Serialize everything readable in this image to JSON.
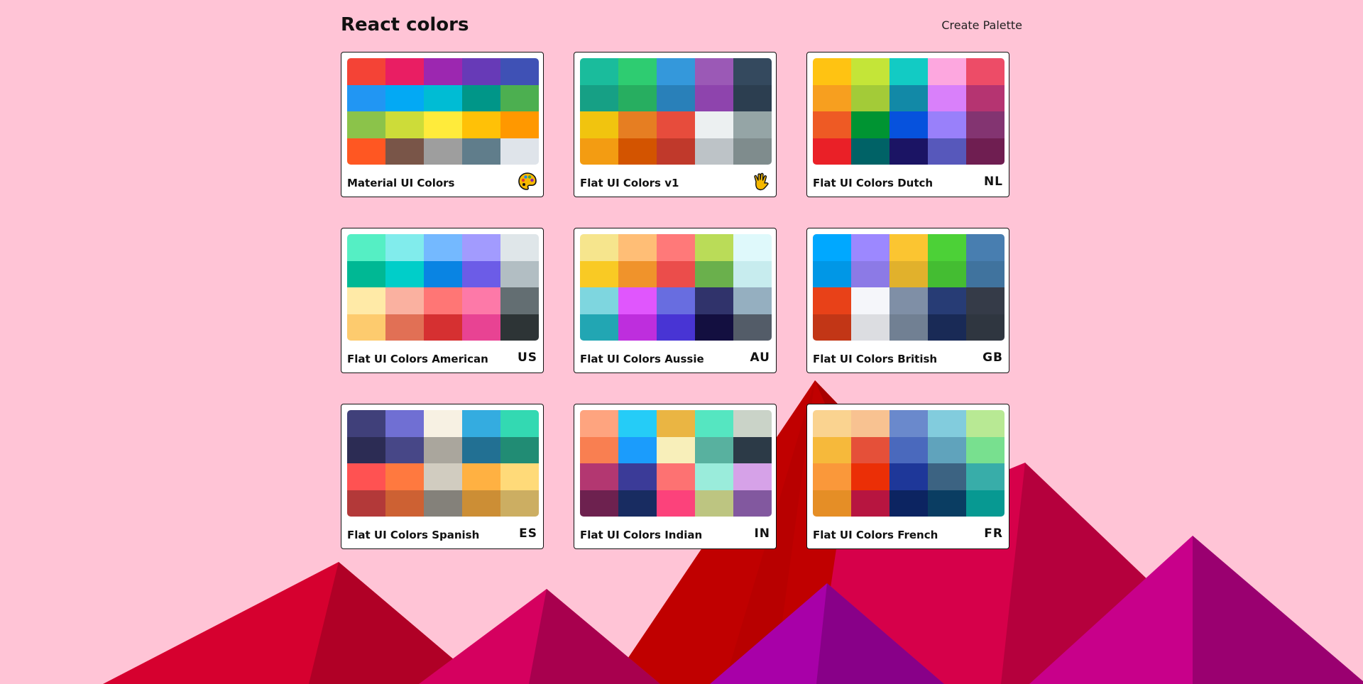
{
  "header": {
    "title": "React colors",
    "create_label": "Create Palette"
  },
  "palettes": [
    {
      "name": "Material UI Colors",
      "emoji": "palette-icon",
      "colors": [
        "#f44336",
        "#e91e63",
        "#9c27b0",
        "#673ab7",
        "#3f51b5",
        "#2196f3",
        "#03a9f4",
        "#00bcd4",
        "#009688",
        "#4caf50",
        "#8bc34a",
        "#cddc39",
        "#ffeb3b",
        "#ffc107",
        "#ff9800",
        "#ff5722",
        "#795548",
        "#9e9e9e",
        "#607d8b",
        "#dfe4ea"
      ]
    },
    {
      "name": "Flat UI Colors v1",
      "emoji": "hand-icon",
      "colors": [
        "#1abc9c",
        "#2ecc71",
        "#3498db",
        "#9b59b6",
        "#34495e",
        "#16a085",
        "#27ae60",
        "#2980b9",
        "#8e44ad",
        "#2c3e50",
        "#f1c40f",
        "#e67e22",
        "#e74c3c",
        "#ecf0f1",
        "#95a5a6",
        "#f39c12",
        "#d35400",
        "#c0392b",
        "#bdc3c7",
        "#7f8c8d"
      ]
    },
    {
      "name": "Flat UI Colors Dutch",
      "emoji": "NL",
      "colors": [
        "#ffc312",
        "#c4e538",
        "#12cbc4",
        "#fda7df",
        "#ed4c67",
        "#f79f1f",
        "#a3cb38",
        "#1289a7",
        "#d980fa",
        "#b53471",
        "#ee5a24",
        "#009432",
        "#0652dd",
        "#9980fa",
        "#833471",
        "#ea2027",
        "#006266",
        "#1b1464",
        "#5758bb",
        "#6f1e51"
      ]
    },
    {
      "name": "Flat UI Colors American",
      "emoji": "US",
      "colors": [
        "#55efc4",
        "#81ecec",
        "#74b9ff",
        "#a29bfe",
        "#dfe6e9",
        "#00b894",
        "#00cec9",
        "#0984e3",
        "#6c5ce7",
        "#b2bec3",
        "#ffeaa7",
        "#fab1a0",
        "#ff7675",
        "#fd79a8",
        "#636e72",
        "#fdcb6e",
        "#e17055",
        "#d63031",
        "#e84393",
        "#2d3436"
      ]
    },
    {
      "name": "Flat UI Colors Aussie",
      "emoji": "AU",
      "colors": [
        "#f6e58d",
        "#ffbe76",
        "#ff7979",
        "#badc58",
        "#dff9fb",
        "#f9ca24",
        "#f0932b",
        "#eb4d4b",
        "#6ab04c",
        "#c7ecee",
        "#7ed6df",
        "#e056fd",
        "#686de0",
        "#30336b",
        "#95afc0",
        "#22a6b3",
        "#be2edd",
        "#4834d4",
        "#130f40",
        "#535c68"
      ]
    },
    {
      "name": "Flat UI Colors British",
      "emoji": "GB",
      "colors": [
        "#00a8ff",
        "#9c88ff",
        "#fbc531",
        "#4cd137",
        "#487eb0",
        "#0097e6",
        "#8c7ae6",
        "#e1b12c",
        "#44bd32",
        "#40739e",
        "#e84118",
        "#f5f6fa",
        "#7f8fa6",
        "#273c75",
        "#353b48",
        "#c23616",
        "#dcdde1",
        "#718093",
        "#192a56",
        "#2f3640"
      ]
    },
    {
      "name": "Flat UI Colors Spanish",
      "emoji": "ES",
      "colors": [
        "#40407a",
        "#706fd3",
        "#f7f1e3",
        "#34ace0",
        "#33d9b2",
        "#2c2c54",
        "#474787",
        "#aaa69d",
        "#227093",
        "#218c74",
        "#ff5252",
        "#ff793f",
        "#d1ccc0",
        "#ffb142",
        "#ffda79",
        "#b33939",
        "#cd6133",
        "#84817a",
        "#cc8e35",
        "#ccae62"
      ]
    },
    {
      "name": "Flat UI Colors Indian",
      "emoji": "IN",
      "colors": [
        "#fea47f",
        "#25ccf7",
        "#eab543",
        "#55e6c1",
        "#cad3c8",
        "#f97f51",
        "#1b9cfc",
        "#f8efba",
        "#58b19f",
        "#2c3a47",
        "#b33771",
        "#3b3b98",
        "#fd7272",
        "#9aecdb",
        "#d6a2e8",
        "#6d214f",
        "#182c61",
        "#fc427b",
        "#bdc581",
        "#82589f"
      ]
    },
    {
      "name": "Flat UI Colors French",
      "emoji": "FR",
      "colors": [
        "#fad390",
        "#f8c291",
        "#6a89cc",
        "#82ccdd",
        "#b8e994",
        "#f6b93b",
        "#e55039",
        "#4a69bd",
        "#60a3bc",
        "#78e08f",
        "#fa983a",
        "#eb2f06",
        "#1e3799",
        "#3c6382",
        "#38ada9",
        "#e58e26",
        "#b71540",
        "#0c2461",
        "#0a3d62",
        "#079992"
      ]
    }
  ]
}
